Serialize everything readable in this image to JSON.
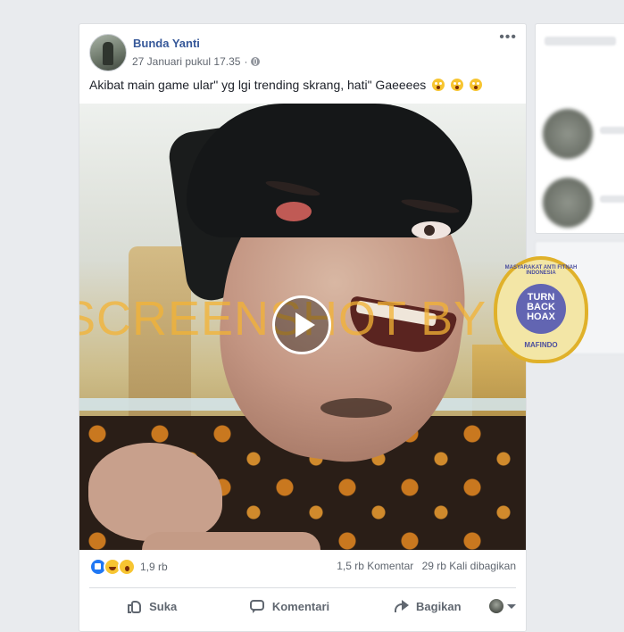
{
  "post": {
    "author": "Bunda Yanti",
    "timestamp": "27 Januari pukul 17.35",
    "separator": "·",
    "privacy_icon": "globe-icon",
    "more_label": "•••",
    "caption": "Akibat main game ular\" yg lgi trending skrang, hati\" Gaeeees",
    "caption_emojis": [
      "astonished-face",
      "astonished-face",
      "astonished-face"
    ]
  },
  "video": {
    "watermark": "SCREENSHOT BY",
    "play_icon": "play-icon"
  },
  "badge": {
    "ring_text": "MASYARAKAT ANTI FITNAH INDONESIA",
    "center_text": "TURN BACK HOAX",
    "footer_text": "MAFINDO",
    "colors": {
      "ring": "#e0b12a",
      "fill": "#f3e6a6",
      "center": "#6265b2"
    }
  },
  "stats": {
    "reactions": [
      "like",
      "haha",
      "wow"
    ],
    "reaction_count": "1,9 rb",
    "comments": "1,5 rb Komentar",
    "shares": "29 rb Kali dibagikan"
  },
  "actions": {
    "like": "Suka",
    "comment": "Komentari",
    "share": "Bagikan"
  },
  "colors": {
    "author_link": "#365899",
    "watermark": "#f4b334",
    "like_blue": "#2078f4",
    "page_bg": "#e9ebee"
  }
}
